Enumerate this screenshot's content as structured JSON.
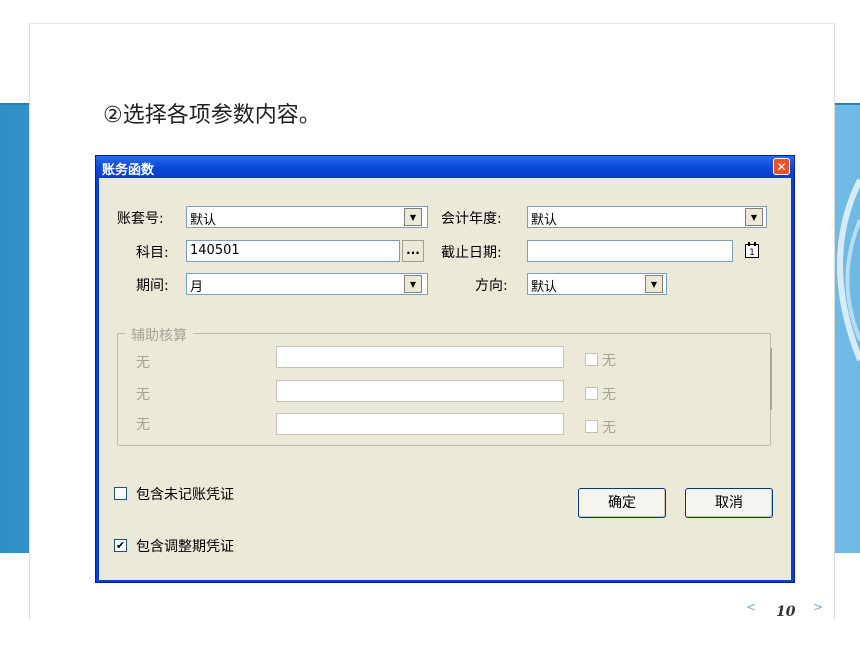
{
  "slide": {
    "title": "②选择各项参数内容。",
    "page_number": "10",
    "nav_prev": "<",
    "nav_next": ">"
  },
  "dialog": {
    "title": "账务函数",
    "close_glyph": "✕",
    "account_set": {
      "label": "账套号:",
      "value": "默认"
    },
    "fiscal_year": {
      "label": "会计年度:",
      "value": "默认"
    },
    "subject": {
      "label": "科目:",
      "value": "140501",
      "browse_label": "..."
    },
    "cutoff_date": {
      "label": "截止日期:",
      "value": ""
    },
    "period": {
      "label": "期间:",
      "value": "月"
    },
    "direction": {
      "label": "方向:",
      "value": "默认"
    },
    "aux_group": {
      "legend": "辅助核算",
      "rows": [
        {
          "label": "无",
          "value": "",
          "check_label": "无",
          "checked": false
        },
        {
          "label": "无",
          "value": "",
          "check_label": "无",
          "checked": false
        },
        {
          "label": "无",
          "value": "",
          "check_label": "无",
          "checked": false
        }
      ]
    },
    "include_unposted": {
      "label": "包含未记账凭证",
      "checked": false,
      "mark": ""
    },
    "include_adjusting": {
      "label": "包含调整期凭证",
      "checked": true,
      "mark": "✔"
    },
    "ok_label": "确定",
    "cancel_label": "取消"
  },
  "colors": {
    "titlebar": "#0a4ad8",
    "dialog_face": "#ece9d8",
    "close_button": "#e5522c"
  }
}
